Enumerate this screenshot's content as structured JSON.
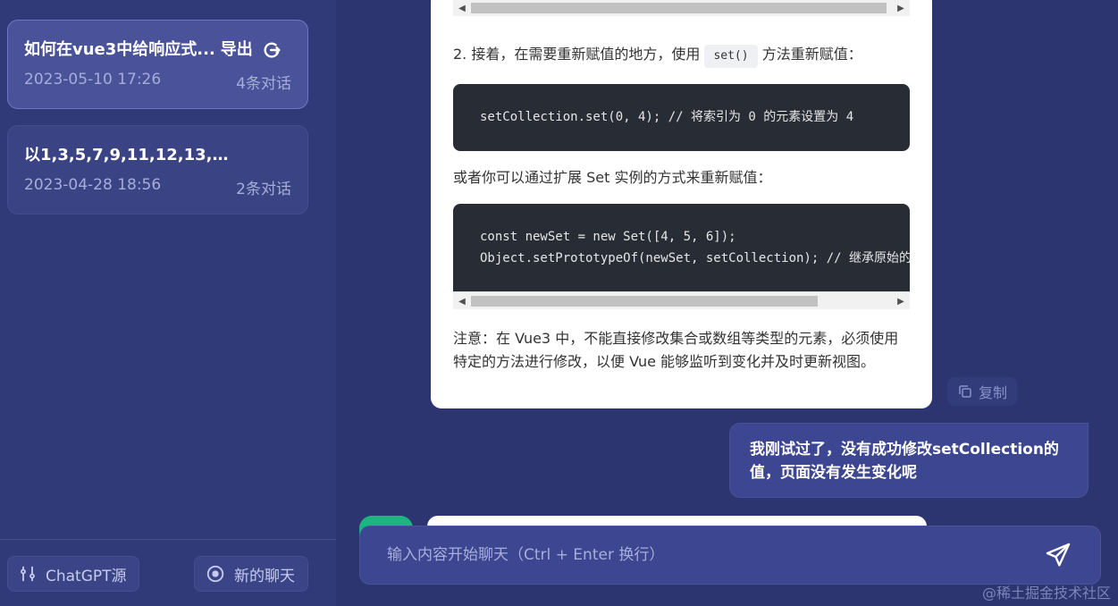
{
  "sidebar": {
    "conversations": [
      {
        "title": "如何在vue3中给响应式...",
        "export_label": "导出",
        "date": "2023-05-10 17:26",
        "count": "4条对话",
        "active": true
      },
      {
        "title": "以1,3,5,7,9,11,12,13,1...",
        "date": "2023-04-28 18:56",
        "count": "2条对话",
        "active": false
      }
    ],
    "source_button": {
      "label": "ChatGPT源",
      "icon": "sliders-icon"
    },
    "new_chat_button": {
      "label": "新的聊天",
      "icon": "plus-circle-icon"
    }
  },
  "messages": {
    "ai": {
      "step2_prefix": "2. 接着，在需要重新赋值的地方，使用",
      "step2_code": "set()",
      "step2_suffix": "方法重新赋值：",
      "code1": "setCollection.set(0, 4); // 将索引为 0 的元素设置为 4",
      "or_text": "或者你可以通过扩展 Set 实例的方式来重新赋值：",
      "code2_line1": "const newSet = new Set([4, 5, 6]);",
      "code2_line2": "Object.setPrototypeOf(newSet, setCollection); // 继承原始的",
      "note": "注意：在 Vue3 中，不能直接修改集合或数组等类型的元素，必须使用特定的方法进行修改，以便 Vue 能够监听到变化并及时更新视图。",
      "copy_label": "复制"
    },
    "user": {
      "text": "我刚试过了，没有成功修改setCollection的值，页面没有发生变化呢"
    }
  },
  "input": {
    "placeholder": "输入内容开始聊天（Ctrl + Enter 换行）",
    "value": ""
  },
  "watermark": "@稀土掘金技术社区",
  "colors": {
    "sidebar_bg": "#313a78",
    "main_bg": "#2d3570",
    "active_card": "#4a539a",
    "user_bubble": "#3d4690",
    "avatar": "#1fb37f",
    "code_bg": "#282c34"
  }
}
